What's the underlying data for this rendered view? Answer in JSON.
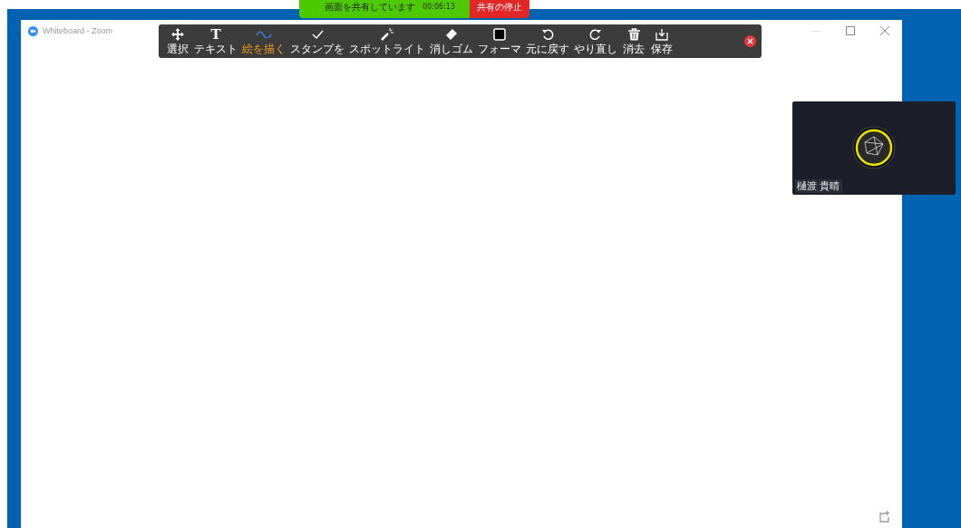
{
  "share_bar": {
    "status": "画面を共有しています",
    "timer": "00:06:13",
    "stop_button": "共有の停止"
  },
  "window": {
    "title": "Whiteboard - Zoom"
  },
  "toolbar": {
    "tools": [
      {
        "kind": "select",
        "label": "選択",
        "selected": false
      },
      {
        "kind": "text",
        "label": "テキスト",
        "icon_glyph": "T",
        "selected": false
      },
      {
        "kind": "draw",
        "label": "絵を描く",
        "selected": true
      },
      {
        "kind": "stamp",
        "label": "スタンプを",
        "selected": false
      },
      {
        "kind": "spotlight",
        "label": "スポットライト",
        "selected": false
      },
      {
        "kind": "eraser",
        "label": "消しゴム",
        "selected": false
      },
      {
        "kind": "format",
        "label": "フォーマ",
        "selected": false
      },
      {
        "kind": "undo",
        "label": "元に戻す",
        "selected": false
      },
      {
        "kind": "redo",
        "label": "やり直し",
        "selected": false
      },
      {
        "kind": "clear",
        "label": "消去",
        "selected": false
      },
      {
        "kind": "save",
        "label": "保存",
        "selected": false
      }
    ]
  },
  "video_tile": {
    "name": "樋渡 貴晴"
  }
}
